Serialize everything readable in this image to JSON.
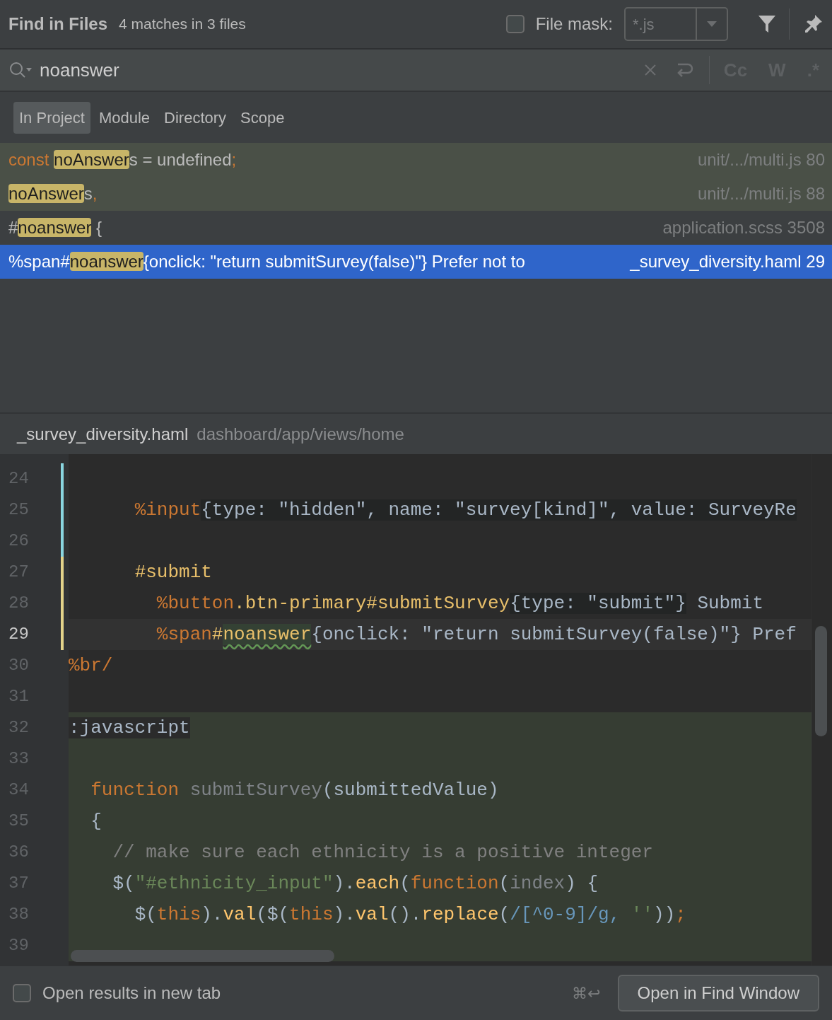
{
  "header": {
    "title": "Find in Files",
    "summary": "4 matches in 3 files",
    "file_mask": {
      "checked": false,
      "label": "File mask:",
      "value": "*.js",
      "disabled": true
    }
  },
  "search": {
    "value": "noanswer",
    "options": [
      {
        "label": "Cc",
        "on": false
      },
      {
        "label": "W",
        "on": false
      },
      {
        "label": ".*",
        "on": false
      }
    ]
  },
  "scopes": [
    {
      "label": "In Project",
      "selected": true
    },
    {
      "label": "Module",
      "selected": false
    },
    {
      "label": "Directory",
      "selected": false
    },
    {
      "label": "Scope",
      "selected": false
    }
  ],
  "results": [
    {
      "tokens": [
        {
          "text": "const ",
          "kind": "keyword"
        },
        {
          "text": "noAnswer",
          "kind": "match"
        },
        {
          "text": "s = undefined",
          "kind": "plain"
        },
        {
          "text": ";",
          "kind": "keyword"
        }
      ],
      "location": "unit/.../multi.js 80",
      "color": "#4a5047",
      "selected": false
    },
    {
      "tokens": [
        {
          "text": "noAnswer",
          "kind": "match"
        },
        {
          "text": "s",
          "kind": "plain"
        },
        {
          "text": ",",
          "kind": "keyword"
        }
      ],
      "location": "unit/.../multi.js 88",
      "color": "#4a5047",
      "selected": false
    },
    {
      "tokens": [
        {
          "text": "#",
          "kind": "plain"
        },
        {
          "text": "noanswer",
          "kind": "match"
        },
        {
          "text": " {",
          "kind": "plain"
        }
      ],
      "location": "application.scss 3508",
      "color": "#3c3f41",
      "selected": false
    },
    {
      "tokens": [
        {
          "text": "%span#",
          "kind": "plain"
        },
        {
          "text": "noanswer",
          "kind": "match"
        },
        {
          "text": "{onclick: \"return submitSurvey(false)\"} Prefer not to",
          "kind": "plain"
        }
      ],
      "location": "_survey_diversity.haml 29",
      "selected": true
    }
  ],
  "preview": {
    "file": "_survey_diversity.haml",
    "path": "dashboard/app/views/home"
  },
  "editor": {
    "lines": [
      {
        "number": "24",
        "kind": "haml",
        "color": "#8ad6e0",
        "current": false
      },
      {
        "number": "25",
        "kind": "haml",
        "color": "#8ad6e0",
        "current": false,
        "tokens": [
          {
            "text": "      %input",
            "kind": "tag"
          },
          {
            "text": "{type: \"hidden\", name: \"survey[kind]\", value: SurveyRe",
            "kind": "attr"
          }
        ]
      },
      {
        "number": "26",
        "kind": "haml",
        "color": "#8ad6e0",
        "current": false
      },
      {
        "number": "27",
        "kind": "haml",
        "color": "#e3d38a",
        "current": false,
        "tokens": [
          {
            "text": "      #submit",
            "kind": "name"
          }
        ]
      },
      {
        "number": "28",
        "kind": "haml",
        "color": "#e3d38a",
        "current": false,
        "tokens": [
          {
            "text": "        %button",
            "kind": "tag"
          },
          {
            "text": ".btn-primary#submitSurvey",
            "kind": "name"
          },
          {
            "text": "{type: \"submit\"}",
            "kind": "attr"
          },
          {
            "text": " Submit",
            "kind": "plain"
          }
        ]
      },
      {
        "number": "29",
        "kind": "haml",
        "color": "#e3d38a",
        "current": true,
        "tokens": [
          {
            "text": "        %span",
            "kind": "tag"
          },
          {
            "text": "#",
            "kind": "name"
          },
          {
            "text": "noanswer",
            "kind": "match"
          },
          {
            "text": "{onclick: \"return submitSurvey(false)\"} Pref",
            "kind": "plain"
          }
        ]
      },
      {
        "number": "30",
        "kind": "haml",
        "current": false,
        "tokens": [
          {
            "text": "%br/",
            "kind": "tag"
          }
        ]
      },
      {
        "number": "31",
        "kind": "haml",
        "current": false
      },
      {
        "number": "32",
        "kind": "script",
        "current": false,
        "tokens": [
          {
            "text": ":javascript",
            "kind": "filter"
          }
        ]
      },
      {
        "number": "33",
        "kind": "script",
        "current": false
      },
      {
        "number": "34",
        "kind": "script",
        "current": false,
        "tokens": [
          {
            "text": "  function ",
            "kind": "keyword"
          },
          {
            "text": "submitSurvey",
            "kind": "dim"
          },
          {
            "text": "(submittedValue)",
            "kind": "plain"
          }
        ]
      },
      {
        "number": "35",
        "kind": "script",
        "current": false,
        "tokens": [
          {
            "text": "  {",
            "kind": "plain"
          }
        ]
      },
      {
        "number": "36",
        "kind": "script",
        "current": false,
        "tokens": [
          {
            "text": "    // make sure each ethnicity is a positive integer",
            "kind": "comment"
          }
        ]
      },
      {
        "number": "37",
        "kind": "script",
        "current": false,
        "tokens": [
          {
            "text": "    $(",
            "kind": "plain"
          },
          {
            "text": "\"#ethnicity_input\"",
            "kind": "string"
          },
          {
            "text": ").",
            "kind": "plain"
          },
          {
            "text": "each",
            "kind": "call"
          },
          {
            "text": "(",
            "kind": "plain"
          },
          {
            "text": "function",
            "kind": "keyword"
          },
          {
            "text": "(",
            "kind": "plain"
          },
          {
            "text": "index",
            "kind": "dim"
          },
          {
            "text": ") {",
            "kind": "plain"
          }
        ]
      },
      {
        "number": "38",
        "kind": "script",
        "current": false,
        "tokens": [
          {
            "text": "      $(",
            "kind": "plain"
          },
          {
            "text": "this",
            "kind": "keyword"
          },
          {
            "text": ").",
            "kind": "plain"
          },
          {
            "text": "val",
            "kind": "call"
          },
          {
            "text": "($(",
            "kind": "plain"
          },
          {
            "text": "this",
            "kind": "keyword"
          },
          {
            "text": ").",
            "kind": "plain"
          },
          {
            "text": "val",
            "kind": "call"
          },
          {
            "text": "().",
            "kind": "plain"
          },
          {
            "text": "replace",
            "kind": "call"
          },
          {
            "text": "(",
            "kind": "plain"
          },
          {
            "text": "/[^0-9]/g, ",
            "kind": "regex"
          },
          {
            "text": "''",
            "kind": "string"
          },
          {
            "text": "))",
            "kind": "plain"
          },
          {
            "text": ";",
            "kind": "keyword"
          }
        ]
      },
      {
        "number": "39",
        "kind": "script",
        "current": false
      }
    ]
  },
  "footer": {
    "new_tab": {
      "label": "Open results in new tab",
      "checked": false
    },
    "shortcut": "⌘↩",
    "button": "Open in Find Window"
  }
}
